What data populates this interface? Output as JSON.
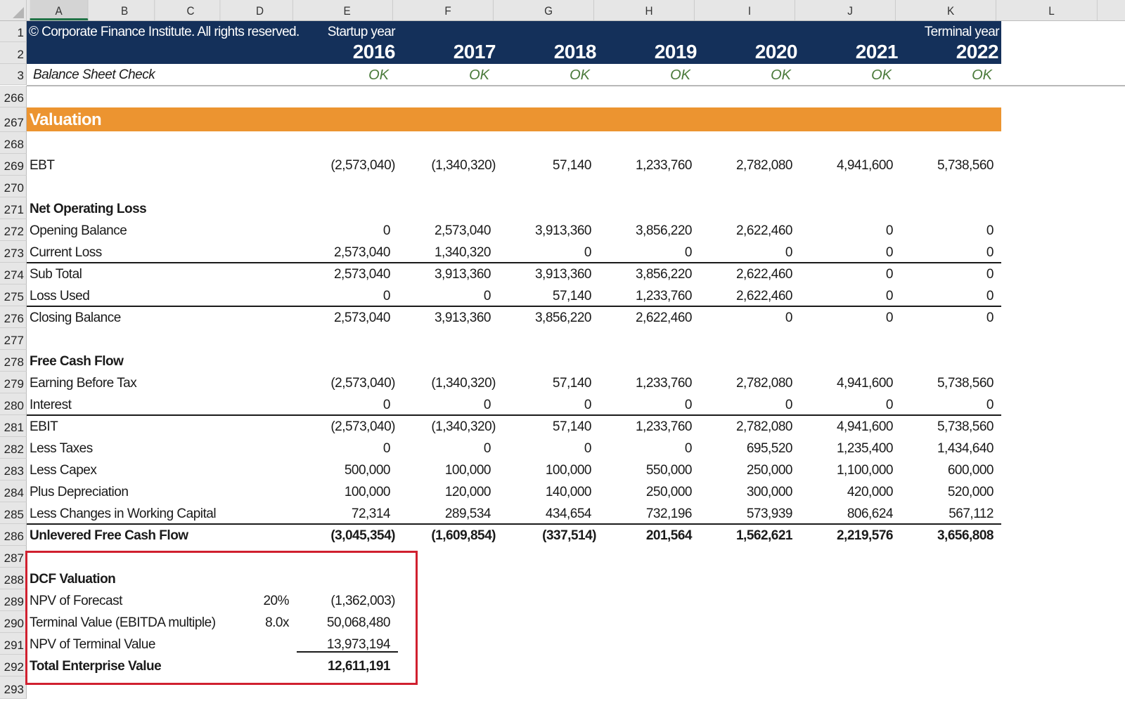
{
  "columns": [
    "A",
    "B",
    "C",
    "D",
    "E",
    "F",
    "G",
    "H",
    "I",
    "J",
    "K",
    "L"
  ],
  "active_column": "A",
  "header": {
    "copyright": "© Corporate Finance Institute. All rights reserved.",
    "startup_label": "Startup year",
    "terminal_label": "Terminal year",
    "years": [
      "2016",
      "2017",
      "2018",
      "2019",
      "2020",
      "2021",
      "2022"
    ],
    "row_numbers": [
      "1",
      "2",
      "3"
    ]
  },
  "balance_check": {
    "label": "Balance Sheet Check",
    "values": [
      "OK",
      "OK",
      "OK",
      "OK",
      "OK",
      "OK",
      "OK"
    ],
    "ok_color": "#4a7a3a"
  },
  "colors": {
    "banner": "#14305a",
    "section": "#ec9430",
    "highlight_box": "#d0202f"
  },
  "section_title": "Valuation",
  "row_numbers": [
    "266",
    "267",
    "268",
    "269",
    "270",
    "271",
    "272",
    "273",
    "274",
    "275",
    "276",
    "277",
    "278",
    "279",
    "280",
    "281",
    "282",
    "283",
    "284",
    "285",
    "286",
    "287",
    "288",
    "289",
    "290",
    "291",
    "292",
    "293"
  ],
  "ebt": {
    "label": "EBT",
    "values": [
      "(2,573,040)",
      "(1,340,320)",
      "57,140",
      "1,233,760",
      "2,782,080",
      "4,941,600",
      "5,738,560"
    ]
  },
  "nol": {
    "title": "Net Operating Loss",
    "rows": [
      {
        "label": "Opening Balance",
        "values": [
          "0",
          "2,573,040",
          "3,913,360",
          "3,856,220",
          "2,622,460",
          "0",
          "0"
        ]
      },
      {
        "label": "Current Loss",
        "values": [
          "2,573,040",
          "1,340,320",
          "0",
          "0",
          "0",
          "0",
          "0"
        ]
      },
      {
        "label": "Sub Total",
        "values": [
          "2,573,040",
          "3,913,360",
          "3,913,360",
          "3,856,220",
          "2,622,460",
          "0",
          "0"
        ]
      },
      {
        "label": "Loss Used",
        "values": [
          "0",
          "0",
          "57,140",
          "1,233,760",
          "2,622,460",
          "0",
          "0"
        ]
      },
      {
        "label": "Closing Balance",
        "values": [
          "2,573,040",
          "3,913,360",
          "3,856,220",
          "2,622,460",
          "0",
          "0",
          "0"
        ]
      }
    ]
  },
  "fcf": {
    "title": "Free Cash Flow",
    "rows": [
      {
        "label": "Earning Before Tax",
        "values": [
          "(2,573,040)",
          "(1,340,320)",
          "57,140",
          "1,233,760",
          "2,782,080",
          "4,941,600",
          "5,738,560"
        ]
      },
      {
        "label": "Interest",
        "values": [
          "0",
          "0",
          "0",
          "0",
          "0",
          "0",
          "0"
        ]
      },
      {
        "label": "EBIT",
        "values": [
          "(2,573,040)",
          "(1,340,320)",
          "57,140",
          "1,233,760",
          "2,782,080",
          "4,941,600",
          "5,738,560"
        ]
      },
      {
        "label": "Less Taxes",
        "values": [
          "0",
          "0",
          "0",
          "0",
          "695,520",
          "1,235,400",
          "1,434,640"
        ]
      },
      {
        "label": "Less Capex",
        "values": [
          "500,000",
          "100,000",
          "100,000",
          "550,000",
          "250,000",
          "1,100,000",
          "600,000"
        ]
      },
      {
        "label": "Plus Depreciation",
        "values": [
          "100,000",
          "120,000",
          "140,000",
          "250,000",
          "300,000",
          "420,000",
          "520,000"
        ]
      },
      {
        "label": "Less Changes in Working Capital",
        "values": [
          "72,314",
          "289,534",
          "434,654",
          "732,196",
          "573,939",
          "806,624",
          "567,112"
        ]
      },
      {
        "label": "Unlevered Free Cash Flow",
        "values": [
          "(3,045,354)",
          "(1,609,854)",
          "(337,514)",
          "201,564",
          "1,562,621",
          "2,219,576",
          "3,656,808"
        ]
      }
    ]
  },
  "dcf": {
    "title": "DCF Valuation",
    "rows": [
      {
        "label": "NPV of Forecast",
        "param": "20%",
        "value": "(1,362,003)"
      },
      {
        "label": "Terminal Value (EBITDA multiple)",
        "param": "8.0x",
        "value": "50,068,480"
      },
      {
        "label": "NPV of Terminal Value",
        "param": "",
        "value": "13,973,194"
      },
      {
        "label": "Total Enterprise Value",
        "param": "",
        "value": "12,611,191"
      }
    ]
  }
}
